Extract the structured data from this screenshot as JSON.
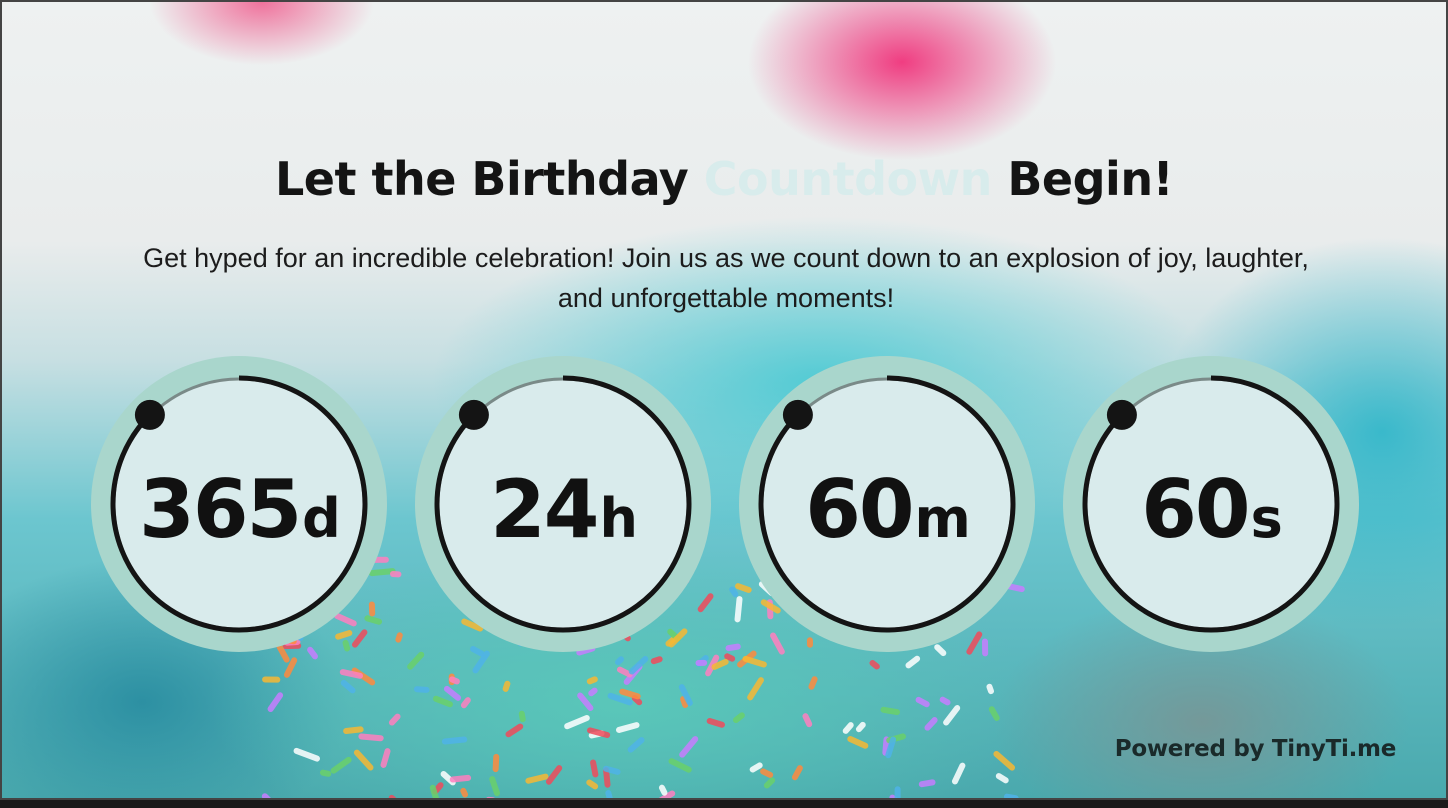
{
  "header": {
    "title_before": "Let the Birthday",
    "title_accent": "Countdown",
    "title_after": "Begin!",
    "subtitle": "Get hyped for an incredible celebration! Join us as we count down to an explosion of joy, laughter, and unforgettable moments!"
  },
  "countdown": [
    {
      "value": "365",
      "unit": "d",
      "progress": 1.0
    },
    {
      "value": "24",
      "unit": "h",
      "progress": 1.0
    },
    {
      "value": "60",
      "unit": "m",
      "progress": 1.0
    },
    {
      "value": "60",
      "unit": "s",
      "progress": 1.0
    }
  ],
  "footer": {
    "powered_by": "Powered by TinyTi.me"
  },
  "colors": {
    "ring_outer": "#a9d6cc",
    "ring_face": "#d9ebec",
    "ring_stroke": "#141414",
    "title_accent": "#d8ecec"
  }
}
